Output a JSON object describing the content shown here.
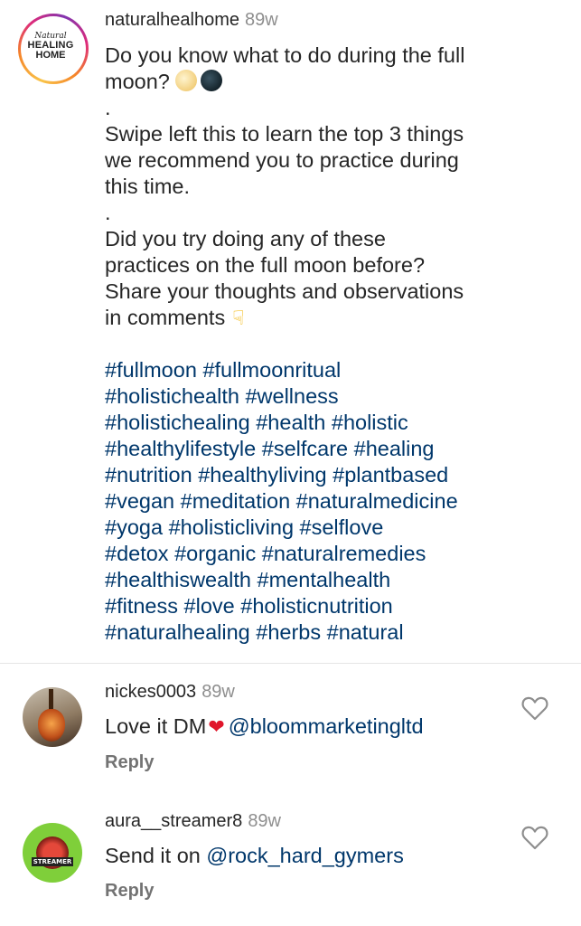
{
  "post": {
    "username": "naturalhealhome",
    "age": "89w",
    "avatar_lines": [
      "Natural",
      "HEALING",
      "HOME"
    ],
    "caption_line1": "Do you know what to do during the full",
    "caption_line2": "moon?",
    "dot1": ".",
    "caption_line3": "Swipe left this to learn the top 3 things",
    "caption_line4": "we recommend you to practice during",
    "caption_line5": "this time.",
    "dot2": ".",
    "caption_line6": "Did you try doing any of these",
    "caption_line7": "practices on the full moon before?",
    "caption_line8": "Share your thoughts and observations",
    "caption_line9": "in comments",
    "hashtag_lines": [
      "#fullmoon #fullmoonritual",
      "#holistichealth #wellness",
      "#holistichealing #health #holistic",
      "#healthylifestyle #selfcare #healing",
      "#nutrition #healthyliving #plantbased",
      "#vegan #meditation #naturalmedicine",
      "#yoga #holisticliving #selflove",
      "#detox #organic #naturalremedies",
      "#healthiswealth #mentalhealth",
      "#fitness #love #holisticnutrition",
      "#naturalhealing #herbs #natural"
    ]
  },
  "comments": [
    {
      "username": "nickes0003",
      "age": "89w",
      "text": "Love it DM",
      "mention": "@bloommarketingltd",
      "reply_label": "Reply"
    },
    {
      "username": "aura__streamer8",
      "age": "89w",
      "text": "Send it on ",
      "mention": "@rock_hard_gymers",
      "reply_label": "Reply",
      "avatar_text": "STREAMER"
    }
  ],
  "icons": {
    "like": "heart-outline-icon",
    "heart_emoji": "red-heart-emoji",
    "moon_emojis": [
      "full-moon-emoji",
      "new-moon-emoji"
    ],
    "hand_emoji": "pointing-down-emoji"
  },
  "colors": {
    "hashtag": "#00376b",
    "meta": "#8e8e8e",
    "heart": "#e0162b"
  }
}
